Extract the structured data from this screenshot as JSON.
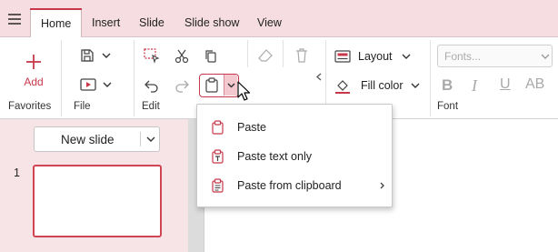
{
  "menubar": {
    "tabs": [
      {
        "label": "Home",
        "active": true
      },
      {
        "label": "Insert"
      },
      {
        "label": "Slide"
      },
      {
        "label": "Slide show"
      },
      {
        "label": "View"
      }
    ]
  },
  "ribbon": {
    "favorites": {
      "add_label": "Add",
      "group_label": "Favorites"
    },
    "file": {
      "group_label": "File"
    },
    "edit": {
      "group_label": "Edit"
    },
    "layout": {
      "layout_label": "Layout",
      "fill_color_label": "Fill color"
    },
    "font": {
      "font_placeholder": "Fonts...",
      "group_label": "Font",
      "underline_label": "U",
      "caps_label": "AB"
    }
  },
  "slides_pane": {
    "new_slide_label": "New slide",
    "slides": [
      {
        "number": "1"
      }
    ]
  },
  "paste_menu": {
    "items": [
      {
        "label": "Paste"
      },
      {
        "label": "Paste text only"
      },
      {
        "label": "Paste from clipboard",
        "has_submenu": true
      }
    ]
  },
  "colors": {
    "accent": "#c8384a",
    "menubar_bg": "#f5dde1",
    "slides_pane_bg": "#f7e4e7"
  }
}
